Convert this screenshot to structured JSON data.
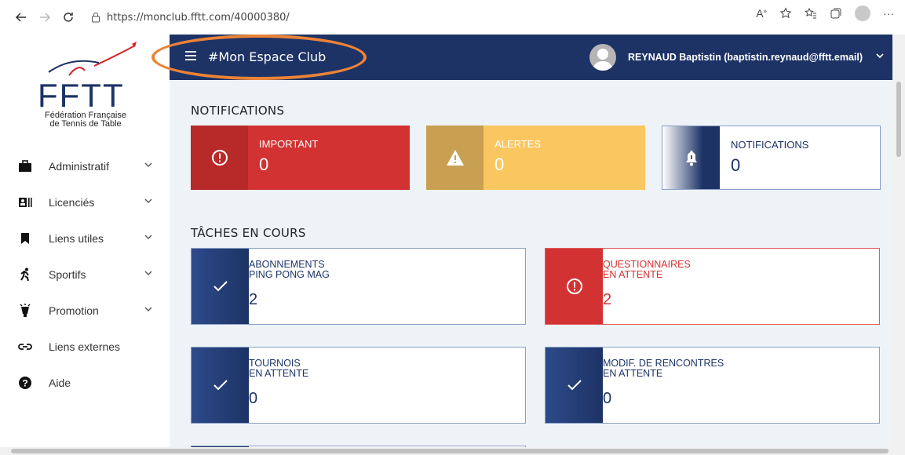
{
  "browser": {
    "url": "https://monclub.fftt.com/40000380/",
    "back_icon": "arrow-left",
    "forward_icon": "arrow-right",
    "reload_icon": "reload",
    "lock_icon": "lock",
    "read_aloud_icon": "read-aloud",
    "favorite_add_icon": "star-add",
    "favorites_icon": "favorites",
    "collections_icon": "collections",
    "more_label": "···"
  },
  "logo": {
    "letters": "FFTT",
    "caption_line1": "Fédération Française",
    "caption_line2": "de Tennis de Table",
    "colors": {
      "navy": "#1d3366",
      "red": "#d8232a"
    }
  },
  "sidebar": {
    "items": [
      {
        "label": "Administratif",
        "icon": "briefcase-icon",
        "has_chevron": true
      },
      {
        "label": "Licenciés",
        "icon": "id-card-icon",
        "has_chevron": true
      },
      {
        "label": "Liens utiles",
        "icon": "bookmark-icon",
        "has_chevron": true
      },
      {
        "label": "Sportifs",
        "icon": "runner-icon",
        "has_chevron": true
      },
      {
        "label": "Promotion",
        "icon": "trophy-icon",
        "has_chevron": true
      },
      {
        "label": "Liens externes",
        "icon": "link-icon",
        "has_chevron": false
      },
      {
        "label": "Aide",
        "icon": "help-icon",
        "has_chevron": false
      }
    ]
  },
  "header": {
    "title": "#Mon Espace Club",
    "user": "REYNAUD Baptistin (baptistin.reynaud@fftt.email)",
    "bg_color": "#1d3366",
    "highlight_color": "#ec8336"
  },
  "notifications": {
    "section_title": "NOTIFICATIONS",
    "cards": [
      {
        "label": "IMPORTANT",
        "count": "0",
        "icon": "exclamation-circle-icon",
        "bg": "#d23232",
        "icon_bg": "#b82929"
      },
      {
        "label": "ALERTES",
        "count": "0",
        "icon": "warning-triangle-icon",
        "bg": "#fac660",
        "icon_bg": "#c9a052"
      },
      {
        "label": "NOTIFICATIONS",
        "count": "0",
        "icon": "bell-icon",
        "bg": "#ffffff",
        "icon_bg": "#1d3366"
      }
    ]
  },
  "tasks": {
    "section_title": "TÂCHES EN COURS",
    "cards": [
      {
        "line1": "ABONNEMENTS",
        "line2": "PING PONG MAG",
        "count": "2",
        "icon": "check-icon",
        "status": "ok"
      },
      {
        "line1": "QUESTIONNAIRES",
        "line2": "EN ATTENTE",
        "count": "2",
        "icon": "exclamation-circle-icon",
        "status": "alert"
      },
      {
        "line1": "TOURNOIS",
        "line2": "EN ATTENTE",
        "count": "0",
        "icon": "check-icon",
        "status": "ok"
      },
      {
        "line1": "MODIF. DE RENCONTRES",
        "line2": "EN ATTENTE",
        "count": "0",
        "icon": "check-icon",
        "status": "ok"
      }
    ]
  }
}
